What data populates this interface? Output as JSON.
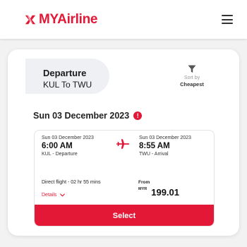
{
  "header": {
    "logo_text": "MYAirline",
    "logo_icon": "airline-logo-mark",
    "menu_icon": "hamburger-menu-icon"
  },
  "search": {
    "title": "Departure",
    "route": "KUL To TWU",
    "sort_by_label": "Sort by",
    "sort_value": "Cheapest",
    "filter_icon": "filter-funnel-icon"
  },
  "date_header": {
    "date": "Sun 03 December 2023",
    "info_icon": "info-icon",
    "info_glyph": "!"
  },
  "flight": {
    "departure": {
      "date": "Sun 03 December 2023",
      "time": "6:00 AM",
      "label": "KUL - Departure"
    },
    "arrival": {
      "date": "Sun 03 December 2023",
      "time": "8:55 AM",
      "label": "TWU - Arrival"
    },
    "plane_icon": "plane-icon",
    "duration": "Direct flight - 02 hr 55 mins",
    "details_label": "Details",
    "from_label": "From",
    "currency": "MYR",
    "price": "199.01",
    "select_label": "Select"
  },
  "colors": {
    "brand_red": "#e31837",
    "pill_bg": "#eef0f4",
    "page_bg": "#f2f2f2"
  }
}
